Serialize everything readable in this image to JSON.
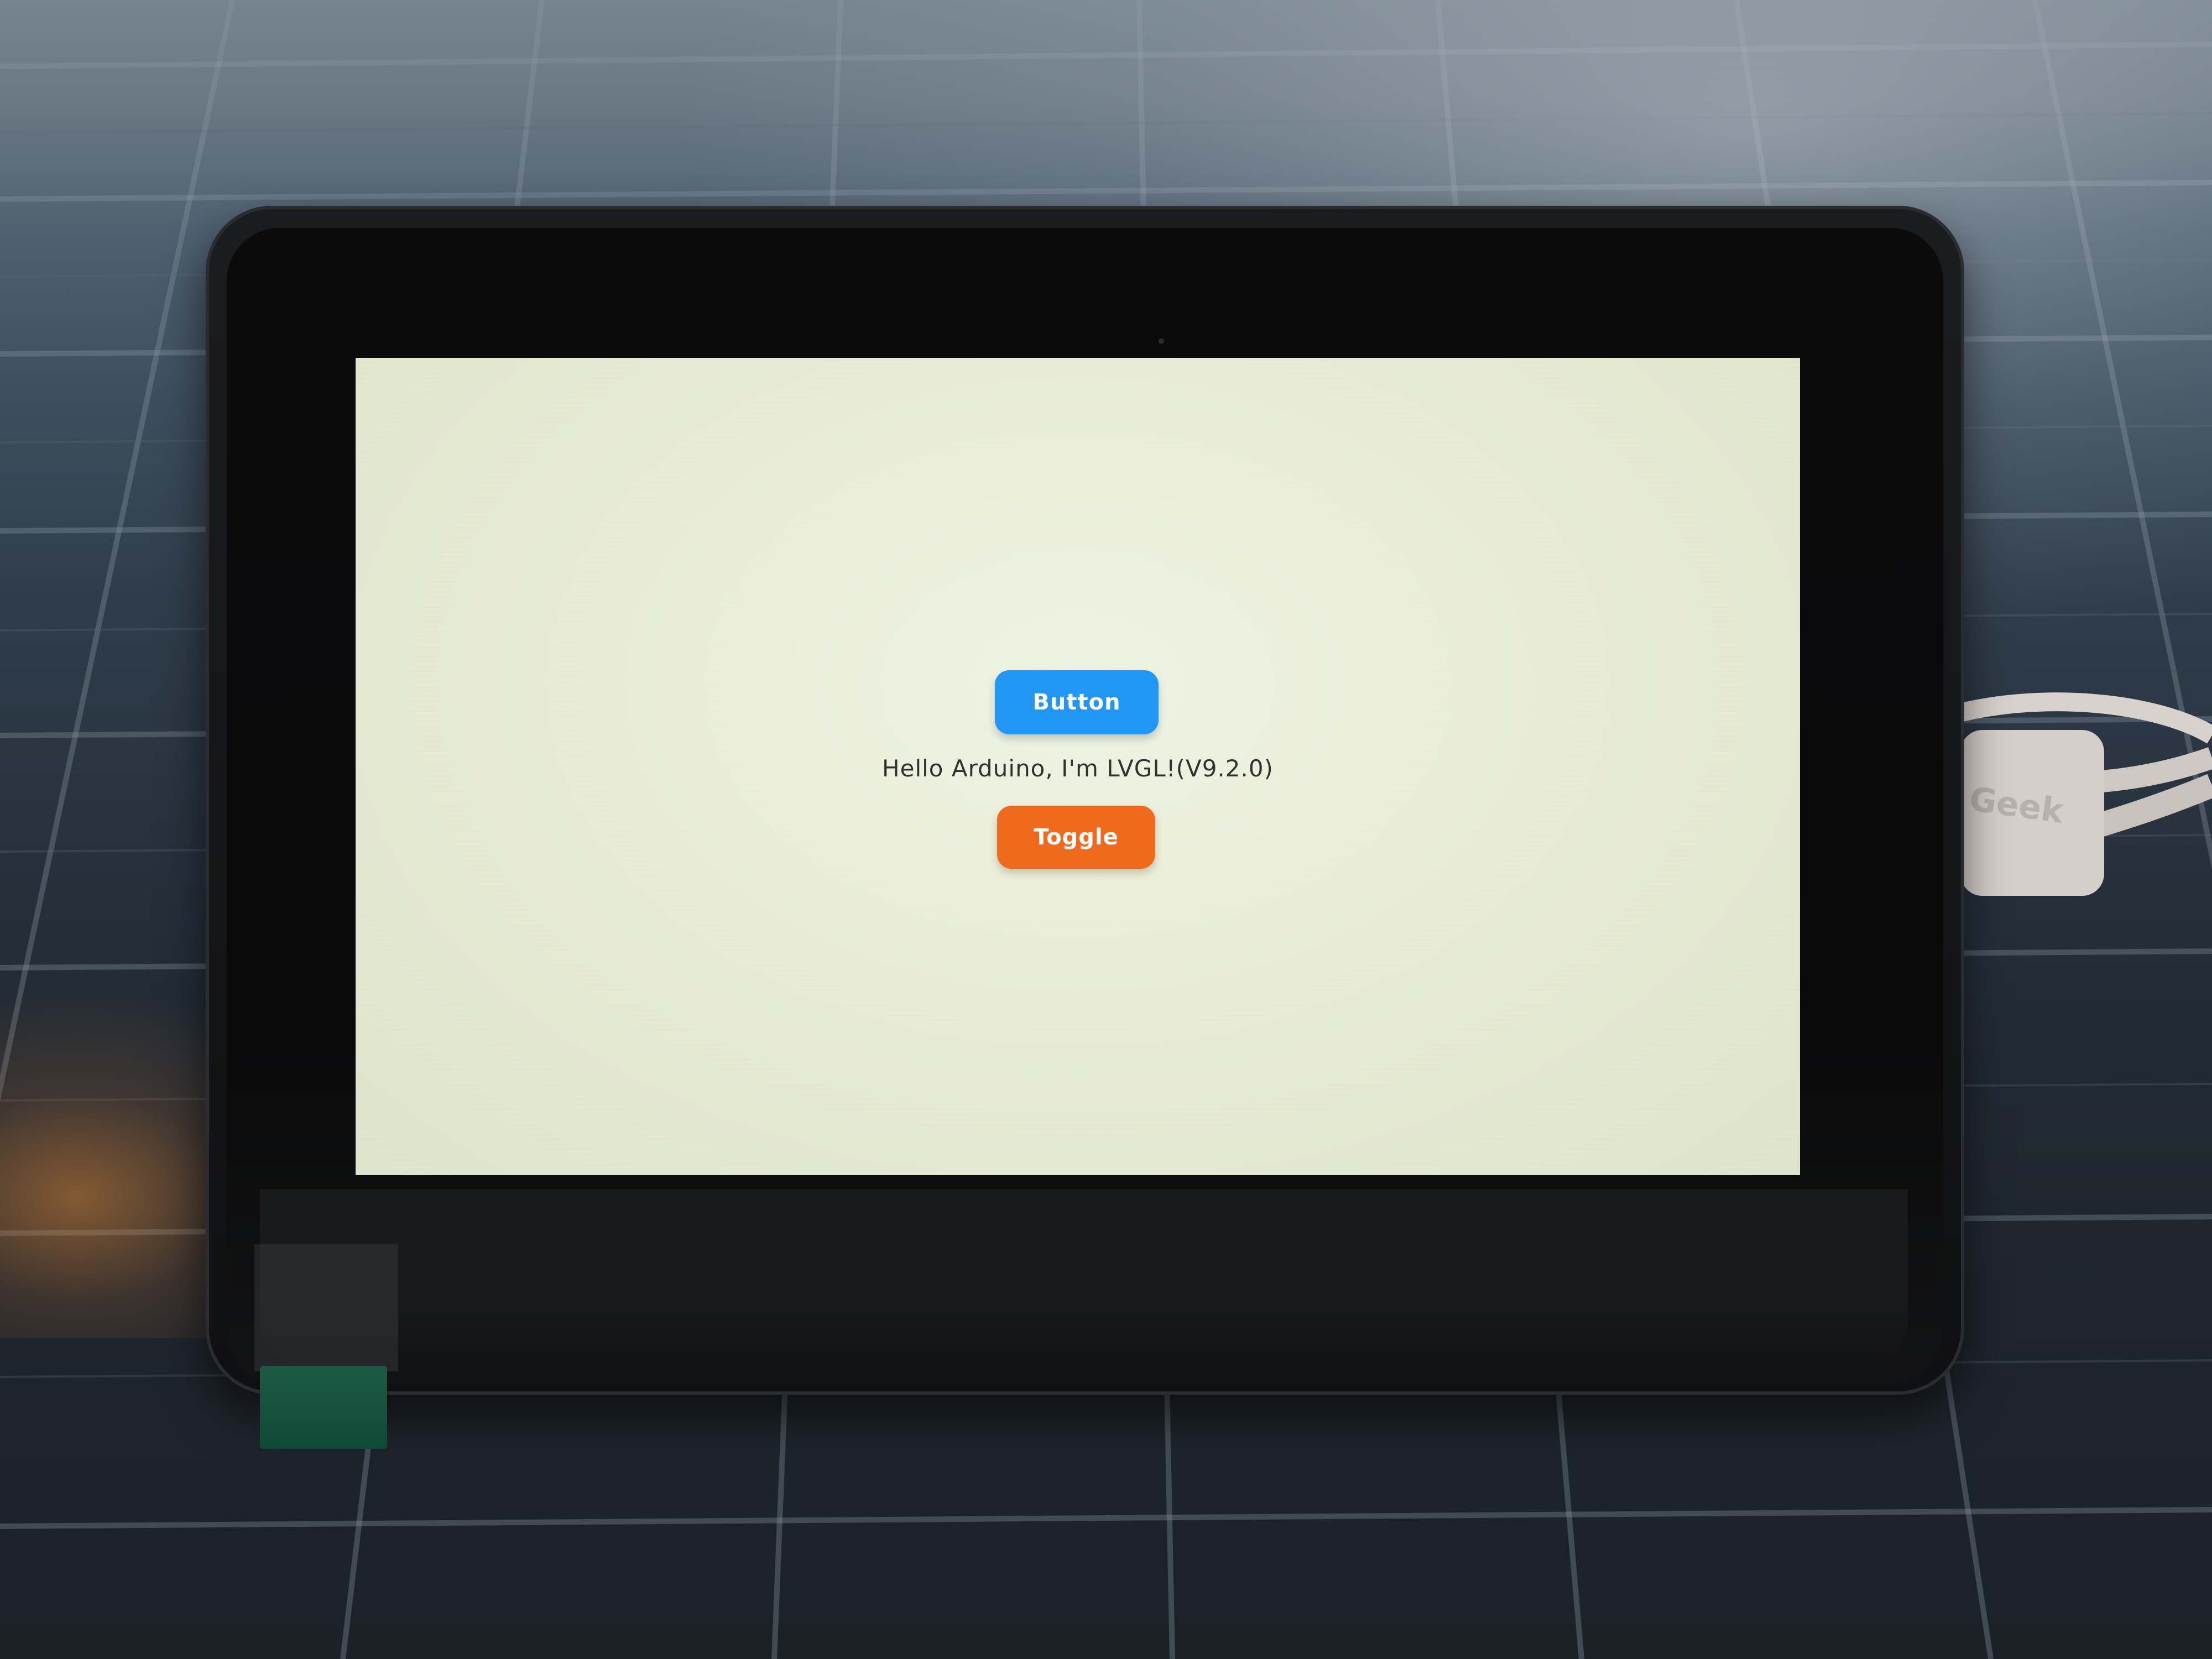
{
  "lcd": {
    "button_label": "Button",
    "toggle_label": "Toggle",
    "hello_text": "Hello Arduino, I'm LVGL!(V9.2.0)"
  },
  "cable": {
    "brand_text": "Geek"
  },
  "colors": {
    "screen_bg": "#e6ebd6",
    "button_blue": "#2196f3",
    "toggle_orange": "#f06a1e",
    "housing": "#141516",
    "tab_green": "#0f4a36"
  }
}
